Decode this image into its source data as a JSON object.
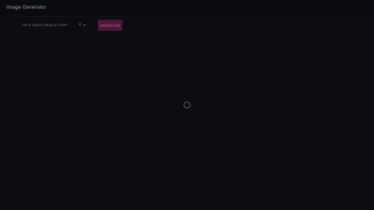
{
  "app": {
    "title": "Image Generator"
  },
  "form": {
    "prompt_placeholder": "cat in space riding a comet",
    "prompt_value": "",
    "count_value": "4",
    "generate_label": "GENERATE"
  },
  "status": {
    "loading_icon": "loading-spinner-icon"
  },
  "colors": {
    "background": "#0c0d12",
    "accent_button": "#4d1739",
    "accent_text": "#b56c99"
  }
}
